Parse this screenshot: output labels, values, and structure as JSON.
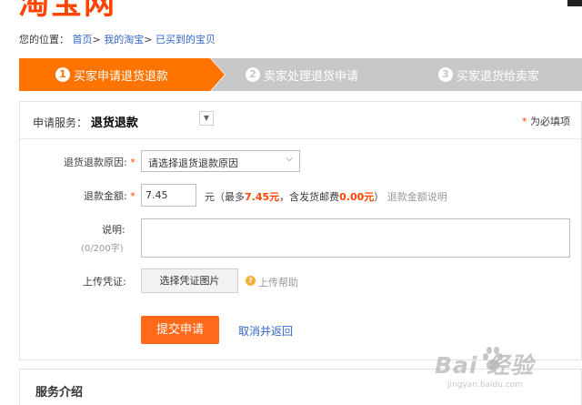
{
  "header": {
    "logo_text": "淘宝网"
  },
  "breadcrumb": {
    "prefix": "您的位置：",
    "items": [
      "首页",
      "我的淘宝",
      "已买到的宝贝"
    ],
    "separator": ">"
  },
  "steps": [
    {
      "number": "1",
      "label": "买家申请退货退款",
      "active": true
    },
    {
      "number": "2",
      "label": "卖家处理退货申请",
      "active": false
    },
    {
      "number": "3",
      "label": "买家退货给卖家",
      "active": false
    }
  ],
  "form": {
    "service_label": "申请服务：",
    "service_value": "退货退款",
    "required_note": "为必填项",
    "reason_label": "退货退款原因:",
    "reason_placeholder": "请选择退货退款原因",
    "amount_label": "退款金额:",
    "amount_value": "7.45",
    "amount_unit": "元",
    "amount_note_prefix": "（最多",
    "amount_max": "7.45元",
    "amount_note_middle": "，含发货邮费",
    "amount_shipping": "0.00元",
    "amount_note_suffix": "）",
    "amount_help_link": "退款金额说明",
    "desc_label": "说明:",
    "desc_count": "(0/200字)",
    "upload_label": "上传凭证:",
    "upload_button": "选择凭证图片",
    "upload_help": "上传帮助",
    "submit_button": "提交申请",
    "cancel_link": "取消并返回"
  },
  "service_intro": {
    "title": "服务介绍"
  },
  "watermark": {
    "brand": "Bai 经验",
    "url": "jingyan.baidu.com"
  },
  "colors": {
    "accent": "#ff7300",
    "inactive_step": "#c8c8c8",
    "link": "#3366cc",
    "required": "#ff4400"
  }
}
